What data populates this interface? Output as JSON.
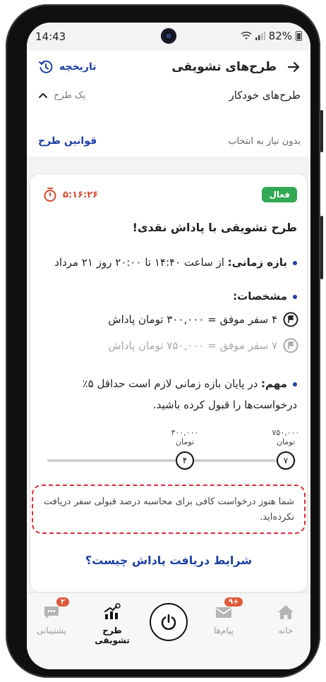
{
  "status": {
    "time": "14:43",
    "battery": "82%"
  },
  "header": {
    "title": "طرح‌های تشویقی",
    "history_label": "تاریخچه",
    "subtitle": "طرح‌های خودکار",
    "plans_count": "یک طرح",
    "no_selection": "بدون نیاز به انتخاب",
    "rules_link": "قوانین طرح"
  },
  "card": {
    "badge": "فعال",
    "timer": "۵:۱۶:۲۶",
    "title": "طرح تشویقی با پاداش نقدی!",
    "period_label": "بازه زمانی:",
    "period_value": "از ساعت ۱۴:۴۰ تا ۲۰:۰۰ روز ۲۱ مرداد",
    "specs_label": "مشخصات:",
    "spec_1": "۴ سفر موفق = ۳۰۰,۰۰۰ تومان پاداش",
    "spec_2": "۷ سفر موفق = ۷۵۰,۰۰۰ تومان پاداش",
    "important_label": "مهم:",
    "important_text": "در پایان بازه زمانی لازم است حداقل ۵٪ درخواست‌ها را قبول کرده باشید.",
    "progress": {
      "amount_1": "۳۰۰,۰۰۰",
      "amount_2": "۷۵۰,۰۰۰",
      "currency": "تومان",
      "node_1": "۴",
      "node_2": "۷"
    },
    "warning": "شما هنوز درخواست کافی برای محاسبه درصد قبولی سفر دریافت نکرده‌اید.",
    "conditions_link": "شرایط دریافت پاداش چیست؟"
  },
  "nav": {
    "home": "خانه",
    "messages": "پیام‌ها",
    "messages_badge": "۹+",
    "incentives": "طرح تشویقی",
    "support": "پشتیبانی",
    "support_badge": "۲"
  },
  "colors": {
    "accent": "#1e3fa6",
    "active": "#32a852",
    "timer": "#d9472e",
    "warning": "#e02a3a"
  }
}
